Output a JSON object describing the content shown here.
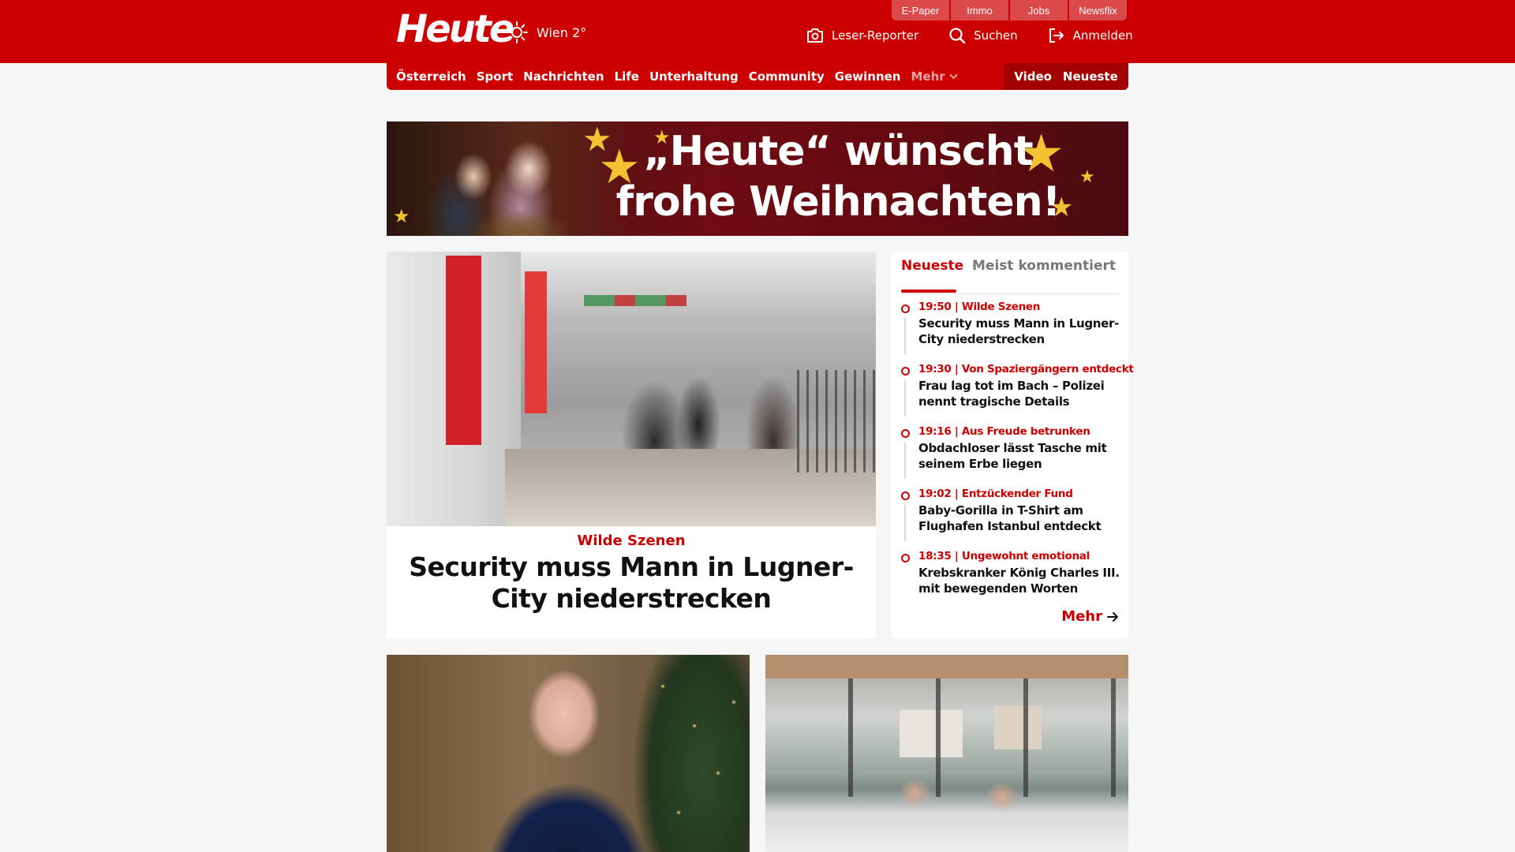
{
  "header": {
    "logo": "Heute",
    "weather": "Wien 2°",
    "service_tabs": [
      "E-Paper",
      "Immo",
      "Jobs",
      "Newsflix"
    ],
    "actions": {
      "reporter": "Leser-Reporter",
      "search": "Suchen",
      "login": "Anmelden"
    }
  },
  "nav": {
    "items": [
      "Österreich",
      "Sport",
      "Nachrichten",
      "Life",
      "Unterhaltung",
      "Community",
      "Gewinnen"
    ],
    "more": "Mehr",
    "right": [
      "Video",
      "Neueste"
    ]
  },
  "banner": {
    "line1": "„Heute“ wünscht",
    "line2": "frohe Weihnachten!"
  },
  "hero": {
    "kicker": "Wilde Szenen",
    "title": "Security muss Mann in Lugner-City niederstrecken"
  },
  "sidebar": {
    "tab_active": "Neueste",
    "tab_inactive": "Meist kommentiert",
    "items": [
      {
        "meta": "19:50 | Wilde Szenen",
        "title": "Security muss Mann in Lugner-City niederstrecken"
      },
      {
        "meta": "19:30 | Von Spaziergängern entdeckt",
        "title": "Frau lag tot im Bach – Polizei nennt tragische Details"
      },
      {
        "meta": "19:16 | Aus Freude betrunken",
        "title": "Obdachloser lässt Tasche mit seinem Erbe liegen"
      },
      {
        "meta": "19:02 | Entzückender Fund",
        "title": "Baby-Gorilla in T-Shirt am Flughafen Istanbul entdeckt"
      },
      {
        "meta": "18:35 | Ungewohnt emotional",
        "title": "Krebskranker König Charles III. mit bewegenden Worten"
      }
    ],
    "more": "Mehr"
  },
  "colors": {
    "brand_red": "#cc0000",
    "nav_dark": "#a30000",
    "background": "#f6f6f6"
  }
}
